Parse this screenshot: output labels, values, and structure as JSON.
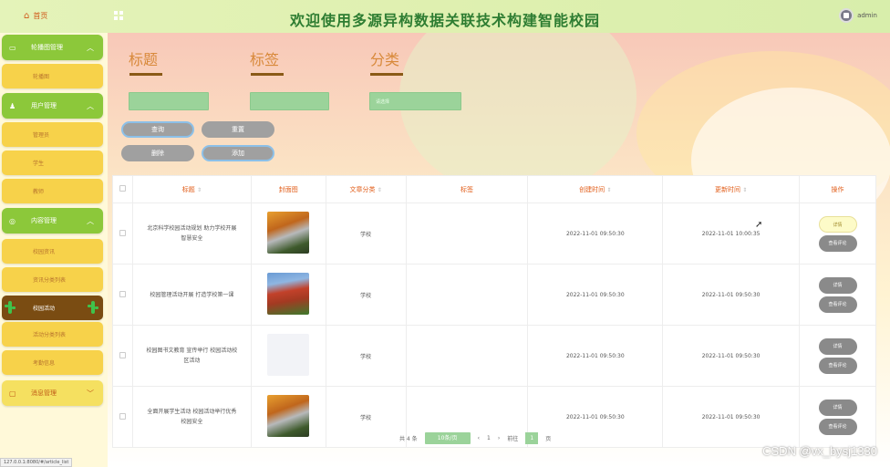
{
  "header": {
    "home_label": "首页",
    "title": "欢迎使用多源异构数据关联技术构建智能校园",
    "user_name": "admin"
  },
  "sidebar": {
    "groups": [
      {
        "label": "轮播图管理",
        "subs": [
          "轮播图"
        ]
      },
      {
        "label": "用户管理",
        "subs": [
          "管理员",
          "学生",
          "教师"
        ]
      },
      {
        "label": "内容管理",
        "subs": [
          "校园资讯",
          "资讯分类列表",
          "校园活动",
          "活动分类列表",
          "考勤信息"
        ]
      },
      {
        "label": "消息管理",
        "subs": []
      }
    ],
    "status_url": "127.0.0.1:8080/#/article_list"
  },
  "filters": {
    "title_label": "标题",
    "tag_label": "标签",
    "category_label": "分类",
    "category_placeholder": "请选择"
  },
  "actions": {
    "search": "查询",
    "reset": "重置",
    "delete": "删除",
    "add": "添加"
  },
  "table": {
    "headers": [
      "标题",
      "封面图",
      "文章分类",
      "标签",
      "创建时间",
      "更新时间",
      "操作"
    ],
    "rows": [
      {
        "title": "北京科学校园活动规划 助力学校开展智慧安全",
        "category": "学校",
        "tag": "",
        "created": "2022-11-01 09:50:30",
        "updated": "2022-11-01 10:00:35",
        "ops": [
          "详情",
          "查看评论"
        ]
      },
      {
        "title": "校园管理活动开展 打造学校第一课",
        "category": "学校",
        "tag": "",
        "created": "2022-11-01 09:50:30",
        "updated": "2022-11-01 09:50:30",
        "ops": [
          "详情",
          "查看评论"
        ]
      },
      {
        "title": "校园图书文教育 宣传举行 校园活动校区活动",
        "category": "学校",
        "tag": "",
        "created": "2022-11-01 09:50:30",
        "updated": "2022-11-01 09:50:30",
        "ops": [
          "详情",
          "查看评论"
        ]
      },
      {
        "title": "全面开展学生活动 校园活动举行优秀校园安全",
        "category": "学校",
        "tag": "",
        "created": "2022-11-01 09:50:30",
        "updated": "2022-11-01 09:50:30",
        "ops": [
          "详情",
          "查看评论"
        ]
      }
    ]
  },
  "pagination": {
    "total": "共 4 条",
    "page_size": "10条/页",
    "current": "1",
    "goto_prefix": "前往",
    "goto_value": "1",
    "goto_suffix": "页"
  },
  "watermark": "CSDN @vx_bysj1330"
}
